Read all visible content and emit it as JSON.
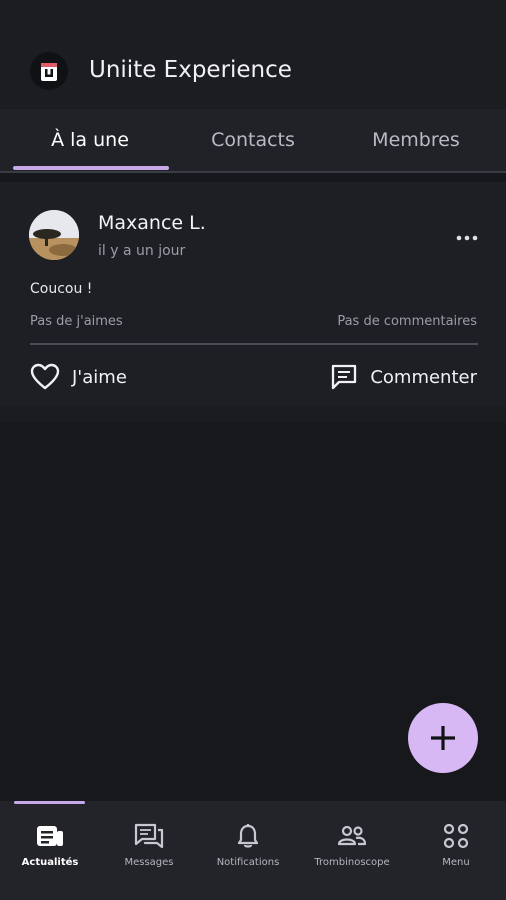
{
  "header": {
    "title": "Uniite Experience",
    "logo_letter": "ü"
  },
  "tabs": [
    {
      "label": "À la une",
      "active": true
    },
    {
      "label": "Contacts",
      "active": false
    },
    {
      "label": "Membres",
      "active": false
    }
  ],
  "post": {
    "author": "Maxance L.",
    "timestamp": "il y a un jour",
    "text": "Coucou !",
    "likes_summary": "Pas de j'aimes",
    "comments_summary": "Pas de commentaires",
    "like_label": "J'aime",
    "comment_label": "Commenter"
  },
  "bottom_nav": [
    {
      "label": "Actualités",
      "icon": "news-icon",
      "active": true
    },
    {
      "label": "Messages",
      "icon": "messages-icon",
      "active": false
    },
    {
      "label": "Notifications",
      "icon": "bell-icon",
      "active": false
    },
    {
      "label": "Trombinoscope",
      "icon": "people-icon",
      "active": false
    },
    {
      "label": "Menu",
      "icon": "grid-icon",
      "active": false
    }
  ],
  "colors": {
    "accent": "#c7a8e8",
    "fab": "#d8b8f4",
    "background": "#17181c"
  }
}
